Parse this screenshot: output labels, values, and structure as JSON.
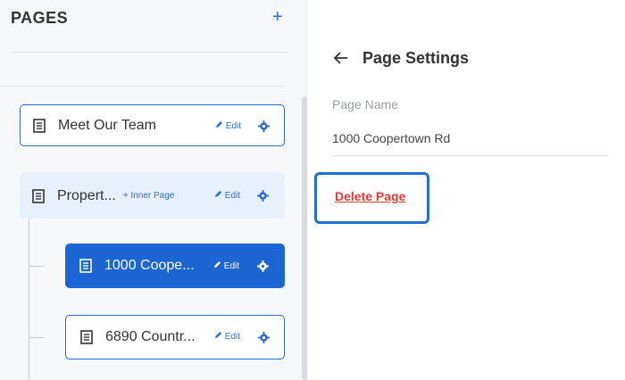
{
  "sidebar": {
    "title": "PAGES",
    "add_icon": "+",
    "items": [
      {
        "label": "Meet Our Team",
        "edit": "Edit"
      },
      {
        "label": "Propert...",
        "inner_page": "+ Inner Page",
        "edit": "Edit"
      },
      {
        "label": "1000 Coope...",
        "edit": "Edit"
      },
      {
        "label": "6890 Countr...",
        "edit": "Edit"
      }
    ]
  },
  "settings": {
    "back_icon": "arrow-left",
    "title": "Page Settings",
    "page_name_label": "Page Name",
    "page_name_value": "1000 Coopertown Rd",
    "delete_label": "Delete Page"
  },
  "colors": {
    "accent": "#2b6fd6",
    "selected_bg": "#1c66d4",
    "danger": "#e53935",
    "highlight_border": "#1f6fd1"
  }
}
